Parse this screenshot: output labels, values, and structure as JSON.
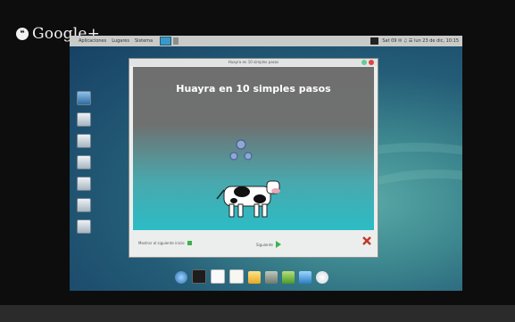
{
  "overlay": {
    "brand": "Google+"
  },
  "panel": {
    "menu": [
      "Aplicaciones",
      "Lugares",
      "Sistema"
    ],
    "right_text": "Sat 09 ✉ ♫ ☰ lun 23 de dic, 10:15"
  },
  "dialog": {
    "window_title": "Huayra en 10 simples pasos",
    "heading": "Huayra en 10 simples pasos",
    "checkbox_label": "Mostrar al siguiente inicio",
    "next_label": "Siguiente"
  },
  "icons": {
    "launchers": [
      "computer-icon",
      "home-icon",
      "drive-icon",
      "drive-icon",
      "camera-icon",
      "drive-icon",
      "drive-icon"
    ],
    "dock": [
      "browser-icon",
      "terminal-icon",
      "document-icon",
      "text-editor-icon",
      "folder-icon",
      "tools-icon",
      "trash-icon",
      "monitor-icon",
      "clock-icon"
    ]
  },
  "colors": {
    "accent_blue": "#3a98c6",
    "next_green": "#3cb24b",
    "close_red": "#c0392b",
    "heading_white": "#ffffff"
  }
}
